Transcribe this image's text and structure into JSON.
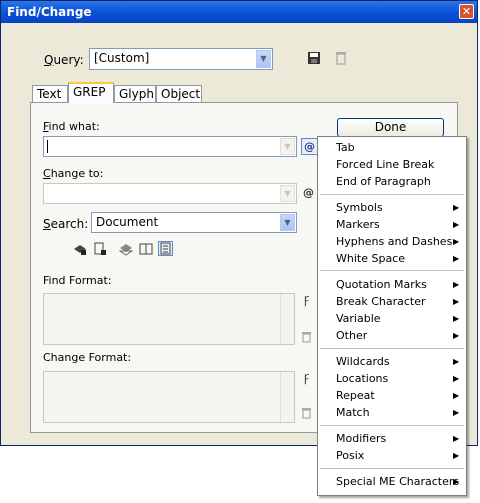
{
  "window": {
    "title": "Find/Change",
    "close_glyph": "✕"
  },
  "query": {
    "label_prefix": "",
    "label_mnemonic": "Q",
    "label_rest": "uery:",
    "value": "[Custom]"
  },
  "tabs": [
    {
      "label": "Text"
    },
    {
      "label": "GREP"
    },
    {
      "label": "Glyph"
    },
    {
      "label": "Object"
    }
  ],
  "find_what": {
    "label_mnemonic": "F",
    "label_rest": "ind what:",
    "value": ""
  },
  "change_to": {
    "label_mnemonic": "C",
    "label_rest": "hange to:",
    "value": ""
  },
  "search": {
    "label_mnemonic": "S",
    "label_rest": "earch:",
    "value": "Document"
  },
  "find_format": {
    "label": "Find Format:"
  },
  "change_format": {
    "label": "Change Format:"
  },
  "buttons": {
    "done": "Done"
  },
  "menu": {
    "groups": [
      [
        "Tab",
        "Forced Line Break",
        "End of Paragraph"
      ],
      [
        "Symbols",
        "Markers",
        "Hyphens and Dashes",
        "White Space"
      ],
      [
        "Quotation Marks",
        "Break Character",
        "Variable",
        "Other"
      ],
      [
        "Wildcards",
        "Locations",
        "Repeat",
        "Match"
      ],
      [
        "Modifiers",
        "Posix"
      ],
      [
        "Special ME Characters"
      ]
    ],
    "submenu_glyph": "▶"
  },
  "colors": {
    "title_bar": "#0a4fd6",
    "dialog_bg": "#ece9d8",
    "active_tab_accent": "#ffc83c"
  }
}
